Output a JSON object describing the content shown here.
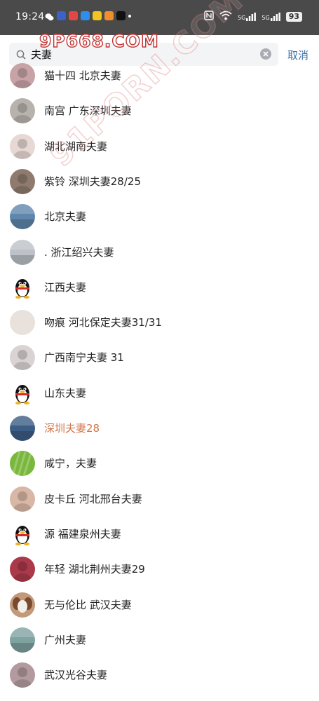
{
  "status": {
    "time": "19:24",
    "battery": "93",
    "network1": "5G",
    "network2": "5G"
  },
  "search": {
    "query": "夫妻",
    "cancel_label": "取消"
  },
  "watermark": {
    "top": "9P668.COM",
    "diagonal": "91PORN.COM"
  },
  "contacts": [
    {
      "name": "猫十四 北京夫妻",
      "avatar": "photo-person",
      "color": "#c7a2a6"
    },
    {
      "name": "南宫  广东深圳夫妻",
      "avatar": "photo-person",
      "color": "#b8b2ad"
    },
    {
      "name": "湖北湖南夫妻",
      "avatar": "photo-person",
      "color": "#e7d8d4"
    },
    {
      "name": "紫铃 深圳夫妻28/25",
      "avatar": "photo-person",
      "color": "#8e7a6e"
    },
    {
      "name": "北京夫妻",
      "avatar": "photo-landscape",
      "color": "#5f87ad"
    },
    {
      "name": ". 浙江绍兴夫妻",
      "avatar": "photo-landscape",
      "color": "#bcc2c7"
    },
    {
      "name": "江西夫妻",
      "avatar": "qq-penguin",
      "color": "#ffffff"
    },
    {
      "name": "吻痕 河北保定夫妻31/31",
      "avatar": "photo-plain",
      "color": "#e9e2dc"
    },
    {
      "name": "广西南宁夫妻 31",
      "avatar": "photo-person",
      "color": "#d9d4d3"
    },
    {
      "name": "山东夫妻",
      "avatar": "qq-penguin",
      "color": "#ffffff"
    },
    {
      "name": "深圳夫妻28",
      "avatar": "photo-landscape",
      "color": "#3c5d84",
      "highlight": true
    },
    {
      "name": "咸宁，夫妻",
      "avatar": "photo-plant",
      "color": "#79b73d"
    },
    {
      "name": "皮卡丘  河北邢台夫妻",
      "avatar": "photo-person",
      "color": "#d9b7a6"
    },
    {
      "name": "源 福建泉州夫妻",
      "avatar": "qq-penguin",
      "color": "#ffffff"
    },
    {
      "name": "年轻 湖北荆州夫妻29",
      "avatar": "photo-person",
      "color": "#a9394b"
    },
    {
      "name": "无与伦比 武汉夫妻",
      "avatar": "photo-dog",
      "color": "#c29a7a"
    },
    {
      "name": "广州夫妻",
      "avatar": "photo-landscape",
      "color": "#7fa3a1"
    },
    {
      "name": "武汉光谷夫妻",
      "avatar": "photo-person",
      "color": "#b39a9e"
    }
  ]
}
